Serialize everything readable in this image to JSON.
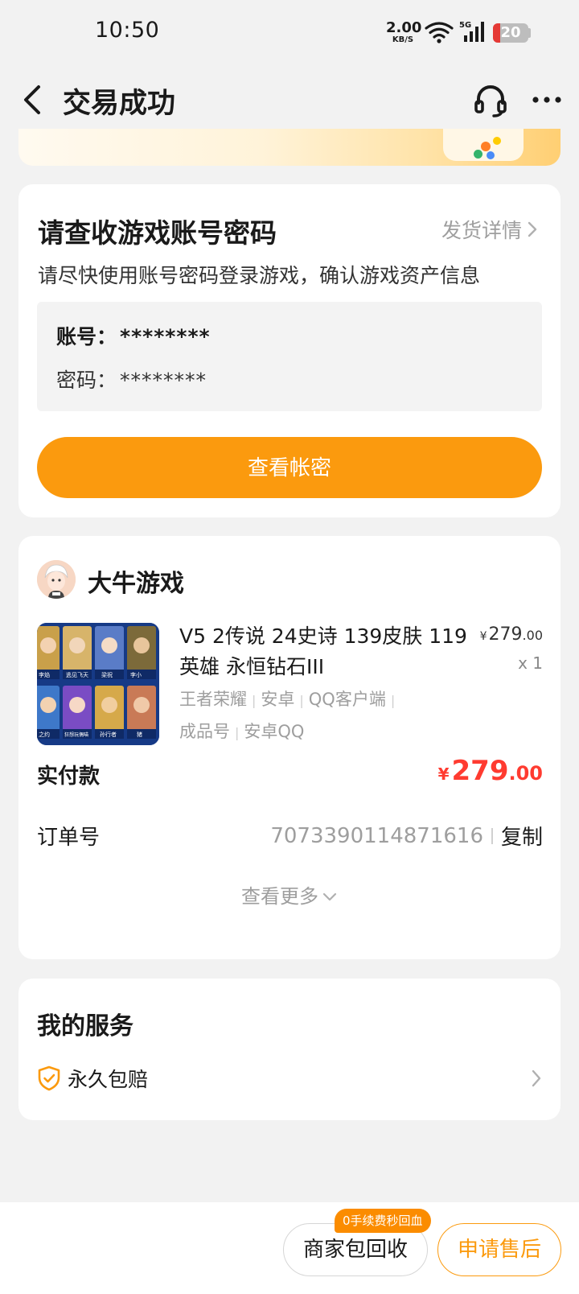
{
  "status_bar": {
    "time": "10:50",
    "net_speed": "2.00",
    "net_unit": "KB/S",
    "network_type": "5G",
    "battery": "20"
  },
  "nav": {
    "title": "交易成功",
    "back_icon": "chevron-left-icon",
    "support_icon": "headset-icon",
    "more_icon": "more-dots-icon"
  },
  "credentials_card": {
    "title": "请查收游戏账号密码",
    "detail_link": "发货详情",
    "subtitle": "请尽快使用账号密码登录游戏，确认游戏资产信息",
    "account_label": "账号：",
    "account_value": "********",
    "password_label": "密码：",
    "password_value": "********",
    "view_button": "查看帐密"
  },
  "order_card": {
    "shop_name": "大牛游戏",
    "product": {
      "title": "V5 2传说 24史诗 139皮肤 119英雄 永恒钻石III",
      "price_currency": "¥",
      "price_int": "279",
      "price_dec": ".00",
      "quantity": "x 1",
      "tags_line1": [
        "王者荣耀",
        "安卓",
        "QQ客户端"
      ],
      "tags_line2": [
        "成品号",
        "安卓QQ"
      ],
      "thumbnail_labels": [
        "李焰",
        "逃见飞天",
        "梁祝",
        "李小",
        "之约",
        "狂想玩偶喵",
        "孙行者",
        "猪"
      ]
    },
    "paid_label": "实付款",
    "paid_currency": "¥",
    "paid_int": "279",
    "paid_dec": ".00",
    "order_label": "订单号",
    "order_number": "7073390114871616",
    "copy_label": "复制",
    "more_label": "查看更多"
  },
  "services_card": {
    "title": "我的服务",
    "item_label": "永久包赔",
    "item_icon": "shield-check-icon"
  },
  "bottom_bar": {
    "badge": "0手续费秒回血",
    "recycle_button": "商家包回收",
    "after_sales_button": "申请售后"
  },
  "colors": {
    "accent": "#fb9a0e",
    "price_red": "#ff3b30",
    "background": "#f2f2f2"
  }
}
